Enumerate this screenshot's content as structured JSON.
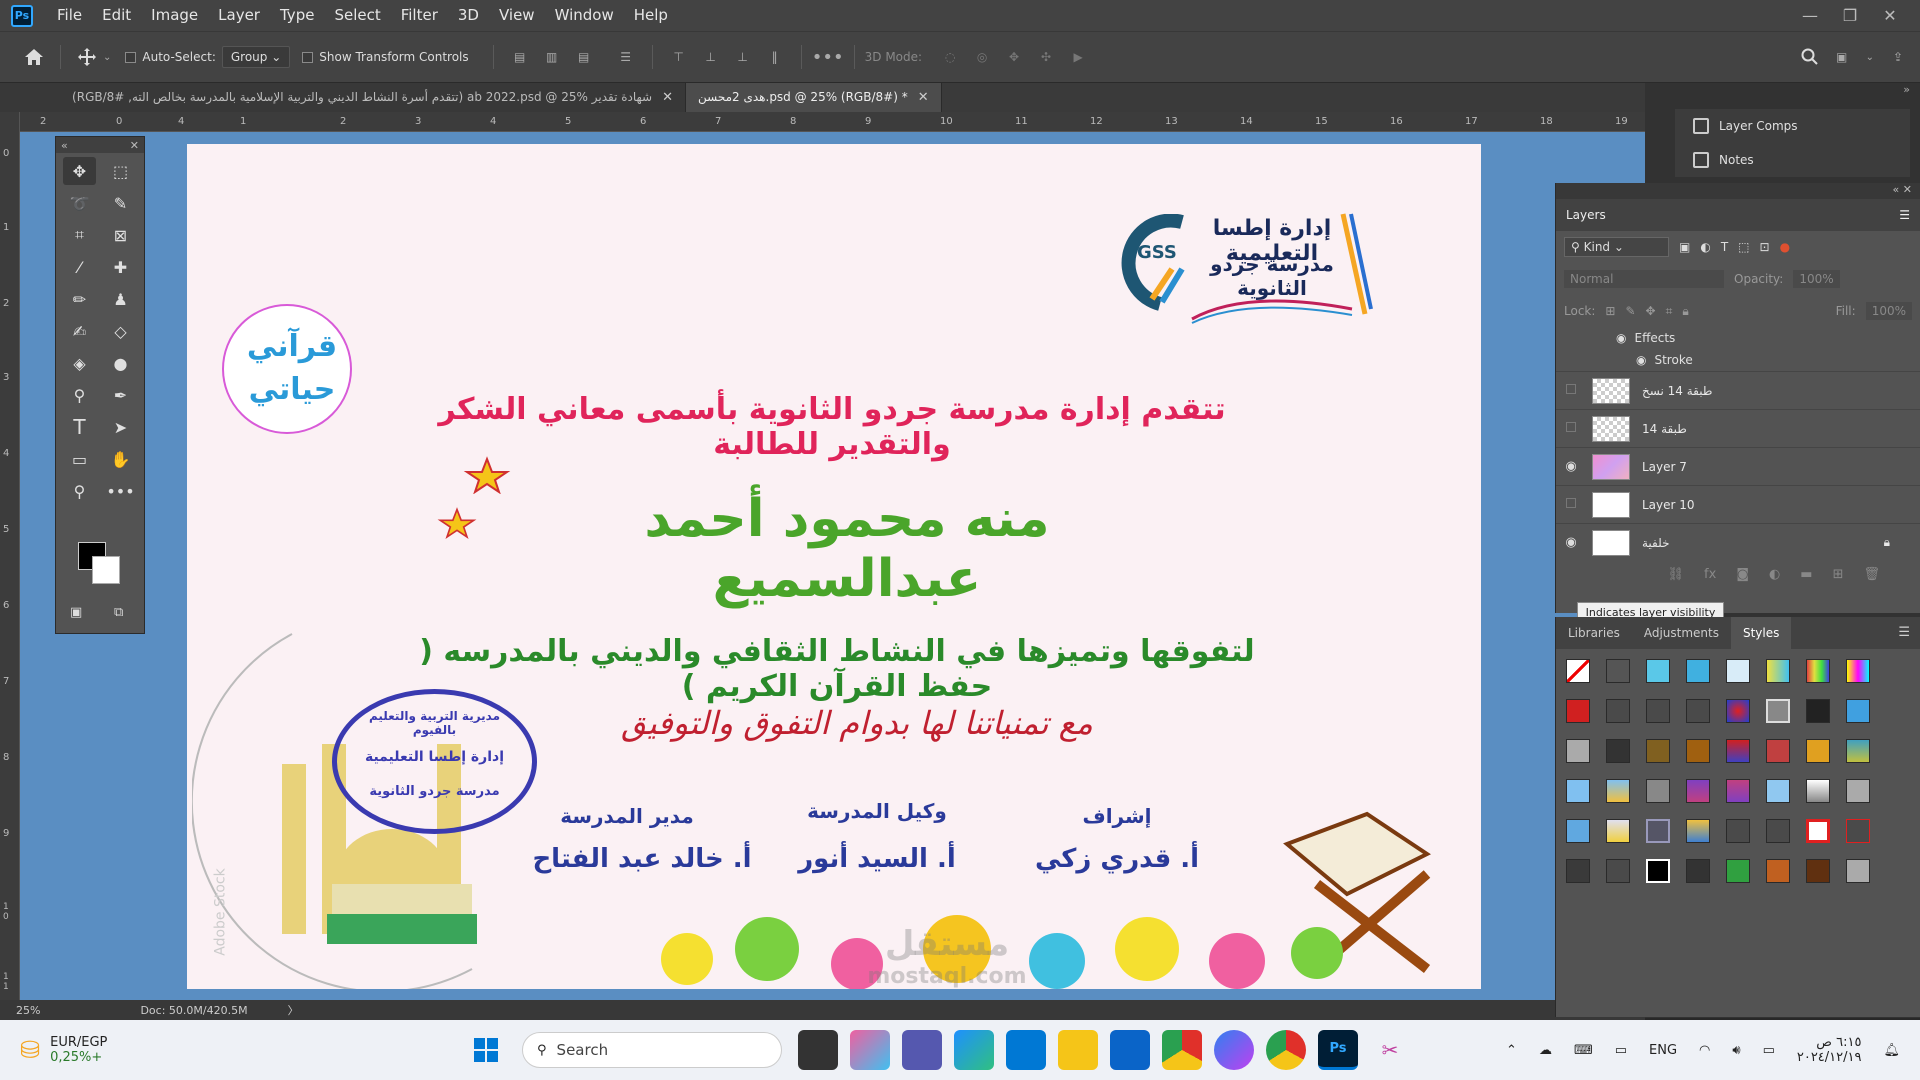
{
  "app": {
    "logo": "Ps"
  },
  "menu": [
    "File",
    "Edit",
    "Image",
    "Layer",
    "Type",
    "Select",
    "Filter",
    "3D",
    "View",
    "Window",
    "Help"
  ],
  "window_controls": {
    "minimize": "—",
    "restore": "❐",
    "close": "✕"
  },
  "options_bar": {
    "auto_select_label": "Auto-Select:",
    "auto_select_value": "Group",
    "show_transform_label": "Show Transform Controls",
    "three_d_mode": "3D Mode:"
  },
  "tabs": [
    {
      "label": "شهادة تقدير ab 2022.psd @ 25% (تتقدم أسرة النشاط الديني والتربية الإسلامية بالمدرسة بخالص الته, RGB/8#)"
    },
    {
      "label": "هدى 2محسن.psd @ 25% (RGB/8#) *"
    }
  ],
  "rulers": {
    "top": [
      "2",
      "0",
      "2",
      "4",
      "1",
      "2",
      "3",
      "4",
      "5",
      "6",
      "7",
      "8",
      "9",
      "10",
      "11",
      "12",
      "13",
      "14",
      "15",
      "16",
      "17",
      "18",
      "19"
    ],
    "left": [
      "0",
      "1",
      "2",
      "3",
      "4",
      "5",
      "6",
      "7",
      "8",
      "9",
      "1 0",
      "1 1"
    ]
  },
  "document": {
    "logo_line1": "إدارة إطسا التعليمية",
    "logo_line2": "مدرسة جردو الثانوية",
    "logo_badge": "GSS",
    "quran_line1": "قرآني",
    "quran_line2": "حياتي",
    "heading": "تتقدم إدارة مدرسة جردو الثانوية  بأسمى معاني الشكر والتقدير للطالبة",
    "student_name": "منه محمود أحمد عبدالسميع",
    "reason": "لتفوقها وتميزها في النشاط الثقافي والديني بالمدرسه  ( حفظ القرآن الكريم )",
    "wish": "مع تمنياتنا لها بدوام التفوق والتوفيق",
    "stamp_line1": "مديرية التربية والتعليم بالفيوم",
    "stamp_line2": "إدارة إطسا التعليمية",
    "stamp_line3": "مدرسة جردو الثانوية",
    "watermark": "Adobe Stock",
    "sig_supervisor_title": "إشراف",
    "sig_supervisor_name": "أ. قدري زكي",
    "sig_deputy_title": "وكيل المدرسة",
    "sig_deputy_name": "أ. السيد أنور",
    "sig_principal_title": "مدير المدرسة",
    "sig_principal_name": "أ. خالد عبد الفتاح",
    "site_watermark": "مستقل",
    "site_watermark_url": "mostaql.com"
  },
  "status": {
    "zoom": "25%",
    "doc_info": "Doc: 50.0M/420.5M",
    "arrow": "〉"
  },
  "right_panel": {
    "items": [
      "Layer Comps",
      "Notes"
    ]
  },
  "layers": {
    "title": "Layers",
    "filter_kind": "Kind",
    "blend_mode": "Normal",
    "opacity_label": "Opacity:",
    "opacity_value": "100%",
    "lock_label": "Lock:",
    "fill_label": "Fill:",
    "fill_value": "100%",
    "effects_label": "Effects",
    "stroke_label": "Stroke",
    "rows": [
      {
        "name": "طبقة 14 نسخ",
        "visible": false
      },
      {
        "name": "طبقة 14",
        "visible": false
      },
      {
        "name": "Layer 7",
        "visible": true
      },
      {
        "name": "Layer 10",
        "visible": false
      },
      {
        "name": "خلفية",
        "visible": true
      }
    ],
    "tooltip": "Indicates layer visibility"
  },
  "styles_panel": {
    "tabs": [
      "Libraries",
      "Adjustments",
      "Styles"
    ]
  },
  "taskbar": {
    "stock_name": "EUR/EGP",
    "stock_change": "0,25%+",
    "search_label": "Search",
    "lang": "ENG",
    "time": "٦:١٥ ص",
    "date": "٢٠٢٤/١٢/١٩"
  }
}
